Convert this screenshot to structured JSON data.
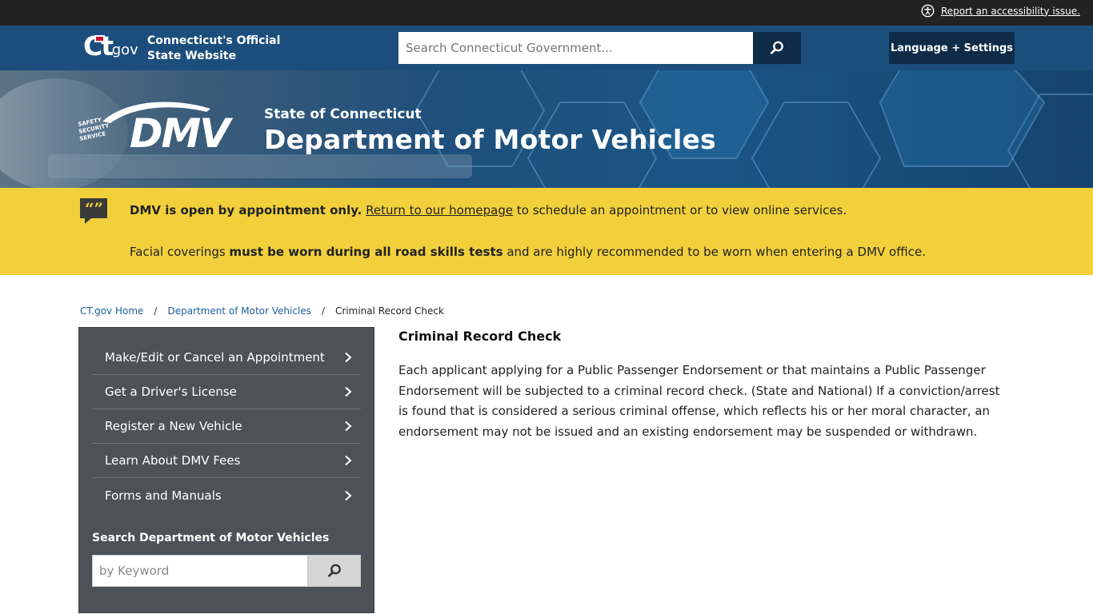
{
  "utility_bar": {
    "accessibility_link": "Report an accessibility issue."
  },
  "ct_header": {
    "logo_text_ct": "Ct",
    "logo_text_gov": ".gov",
    "site_title_line1": "Connecticut's Official",
    "site_title_line2": "State Website",
    "search_placeholder": "Search Connecticut Government...",
    "language_button": "Language + Settings"
  },
  "banner": {
    "logo_tagline": "SAFETY SECURITY SERVICE",
    "logo_text": "DMV",
    "agency_subtitle": "State of Connecticut",
    "agency_name": "Department of Motor Vehicles"
  },
  "alert": {
    "line1_bold": "DMV is open by appointment only.",
    "line1_link": "Return to our homepage",
    "line1_rest": " to schedule an appointment or to view online services.",
    "line2_pre": "Facial coverings ",
    "line2_bold": "must be worn during all road skills tests",
    "line2_post": " and are highly recommended to be worn when entering a DMV office."
  },
  "breadcrumb": {
    "items": [
      "CT.gov Home",
      "Department of Motor Vehicles",
      "Criminal Record Check"
    ],
    "separator": "/"
  },
  "sidenav": {
    "items": [
      {
        "label": "Make/Edit or Cancel an Appointment"
      },
      {
        "label": "Get a Driver's License"
      },
      {
        "label": "Register a New Vehicle"
      },
      {
        "label": "Learn About DMV Fees"
      },
      {
        "label": "Forms and Manuals"
      }
    ],
    "search_title": "Search Department of Motor Vehicles",
    "search_placeholder": "by Keyword"
  },
  "content": {
    "title": "Criminal Record Check",
    "body": "Each applicant applying for a Public Passenger Endorsement or that maintains a Public Passenger Endorsement will be subjected to a criminal record check.  (State and National)  If a conviction/arrest is found that is considered a serious criminal offense, which reflects his or her moral character, an endorsement may not be issued and an existing endorsement may be suspended or withdrawn."
  },
  "colors": {
    "utility_bar": "#222222",
    "header_blue": "#1c4e7d",
    "dark_button": "#0e2b47",
    "alert_yellow": "#f2d03c",
    "sidenav_gray": "#4c5258",
    "link_blue": "#1c5d9c"
  },
  "icons": {
    "accessibility": "accessibility-icon",
    "search": "search-icon",
    "quote": "quote-icon",
    "chevron": "chevron-right-icon"
  }
}
